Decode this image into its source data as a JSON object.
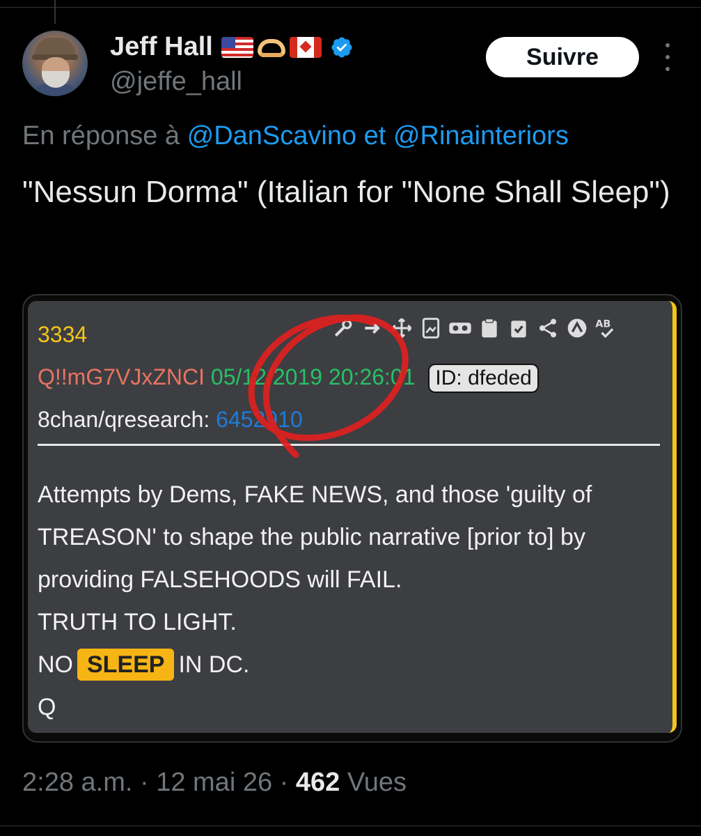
{
  "author": {
    "name": "Jeff Hall",
    "handle": "@jeffe_hall",
    "flags": [
      "us-flag",
      "heart-hands",
      "canada-flag"
    ],
    "verified": true
  },
  "actions": {
    "follow_label": "Suivre"
  },
  "reply": {
    "prefix": "En réponse à",
    "mention1": "@DanScavino",
    "joiner": "et",
    "mention2": "@Rinainteriors"
  },
  "tweet": {
    "text": "\"Nessun Dorma\" (Italian for \"None Shall Sleep\")"
  },
  "card": {
    "post_number": "3334",
    "tripcode": "Q!!mG7VJxZNCI",
    "date": "05/12/2019 20:26:01",
    "id_badge": "ID: dfeded",
    "board": "8chan/qresearch:",
    "post_link": "6452910",
    "icons": [
      "key-icon",
      "arrow-icon",
      "move-icon",
      "image-icon",
      "vr-icon",
      "clipboard-icon",
      "clipboard-check-icon",
      "share-icon",
      "up-icon",
      "translate-icon"
    ],
    "body": {
      "line1": "Attempts by Dems, FAKE NEWS, and those 'guilty of TREASON' to shape the public narrative [prior to] by providing FALSEHOODS will FAIL.",
      "line2": "TRUTH TO LIGHT.",
      "line3_pre": "NO",
      "line3_highlight": "SLEEP",
      "line3_post": "IN DC.",
      "line4": "Q"
    },
    "colors": {
      "post_bg": "#3d3e42",
      "number": "#f5c518",
      "tripcode": "#e87461",
      "date": "#28c066",
      "highlight": "#f6b514",
      "annotation": "#e02020"
    }
  },
  "footer": {
    "time": "2:28 a.m.",
    "sep1": "·",
    "date": "12 mai 26",
    "sep2": "·",
    "views_count": "462",
    "views_label": "Vues"
  },
  "colors": {
    "background": "#000000",
    "text": "#e7e9ea",
    "muted": "#71767b",
    "link": "#1d9bf0"
  }
}
